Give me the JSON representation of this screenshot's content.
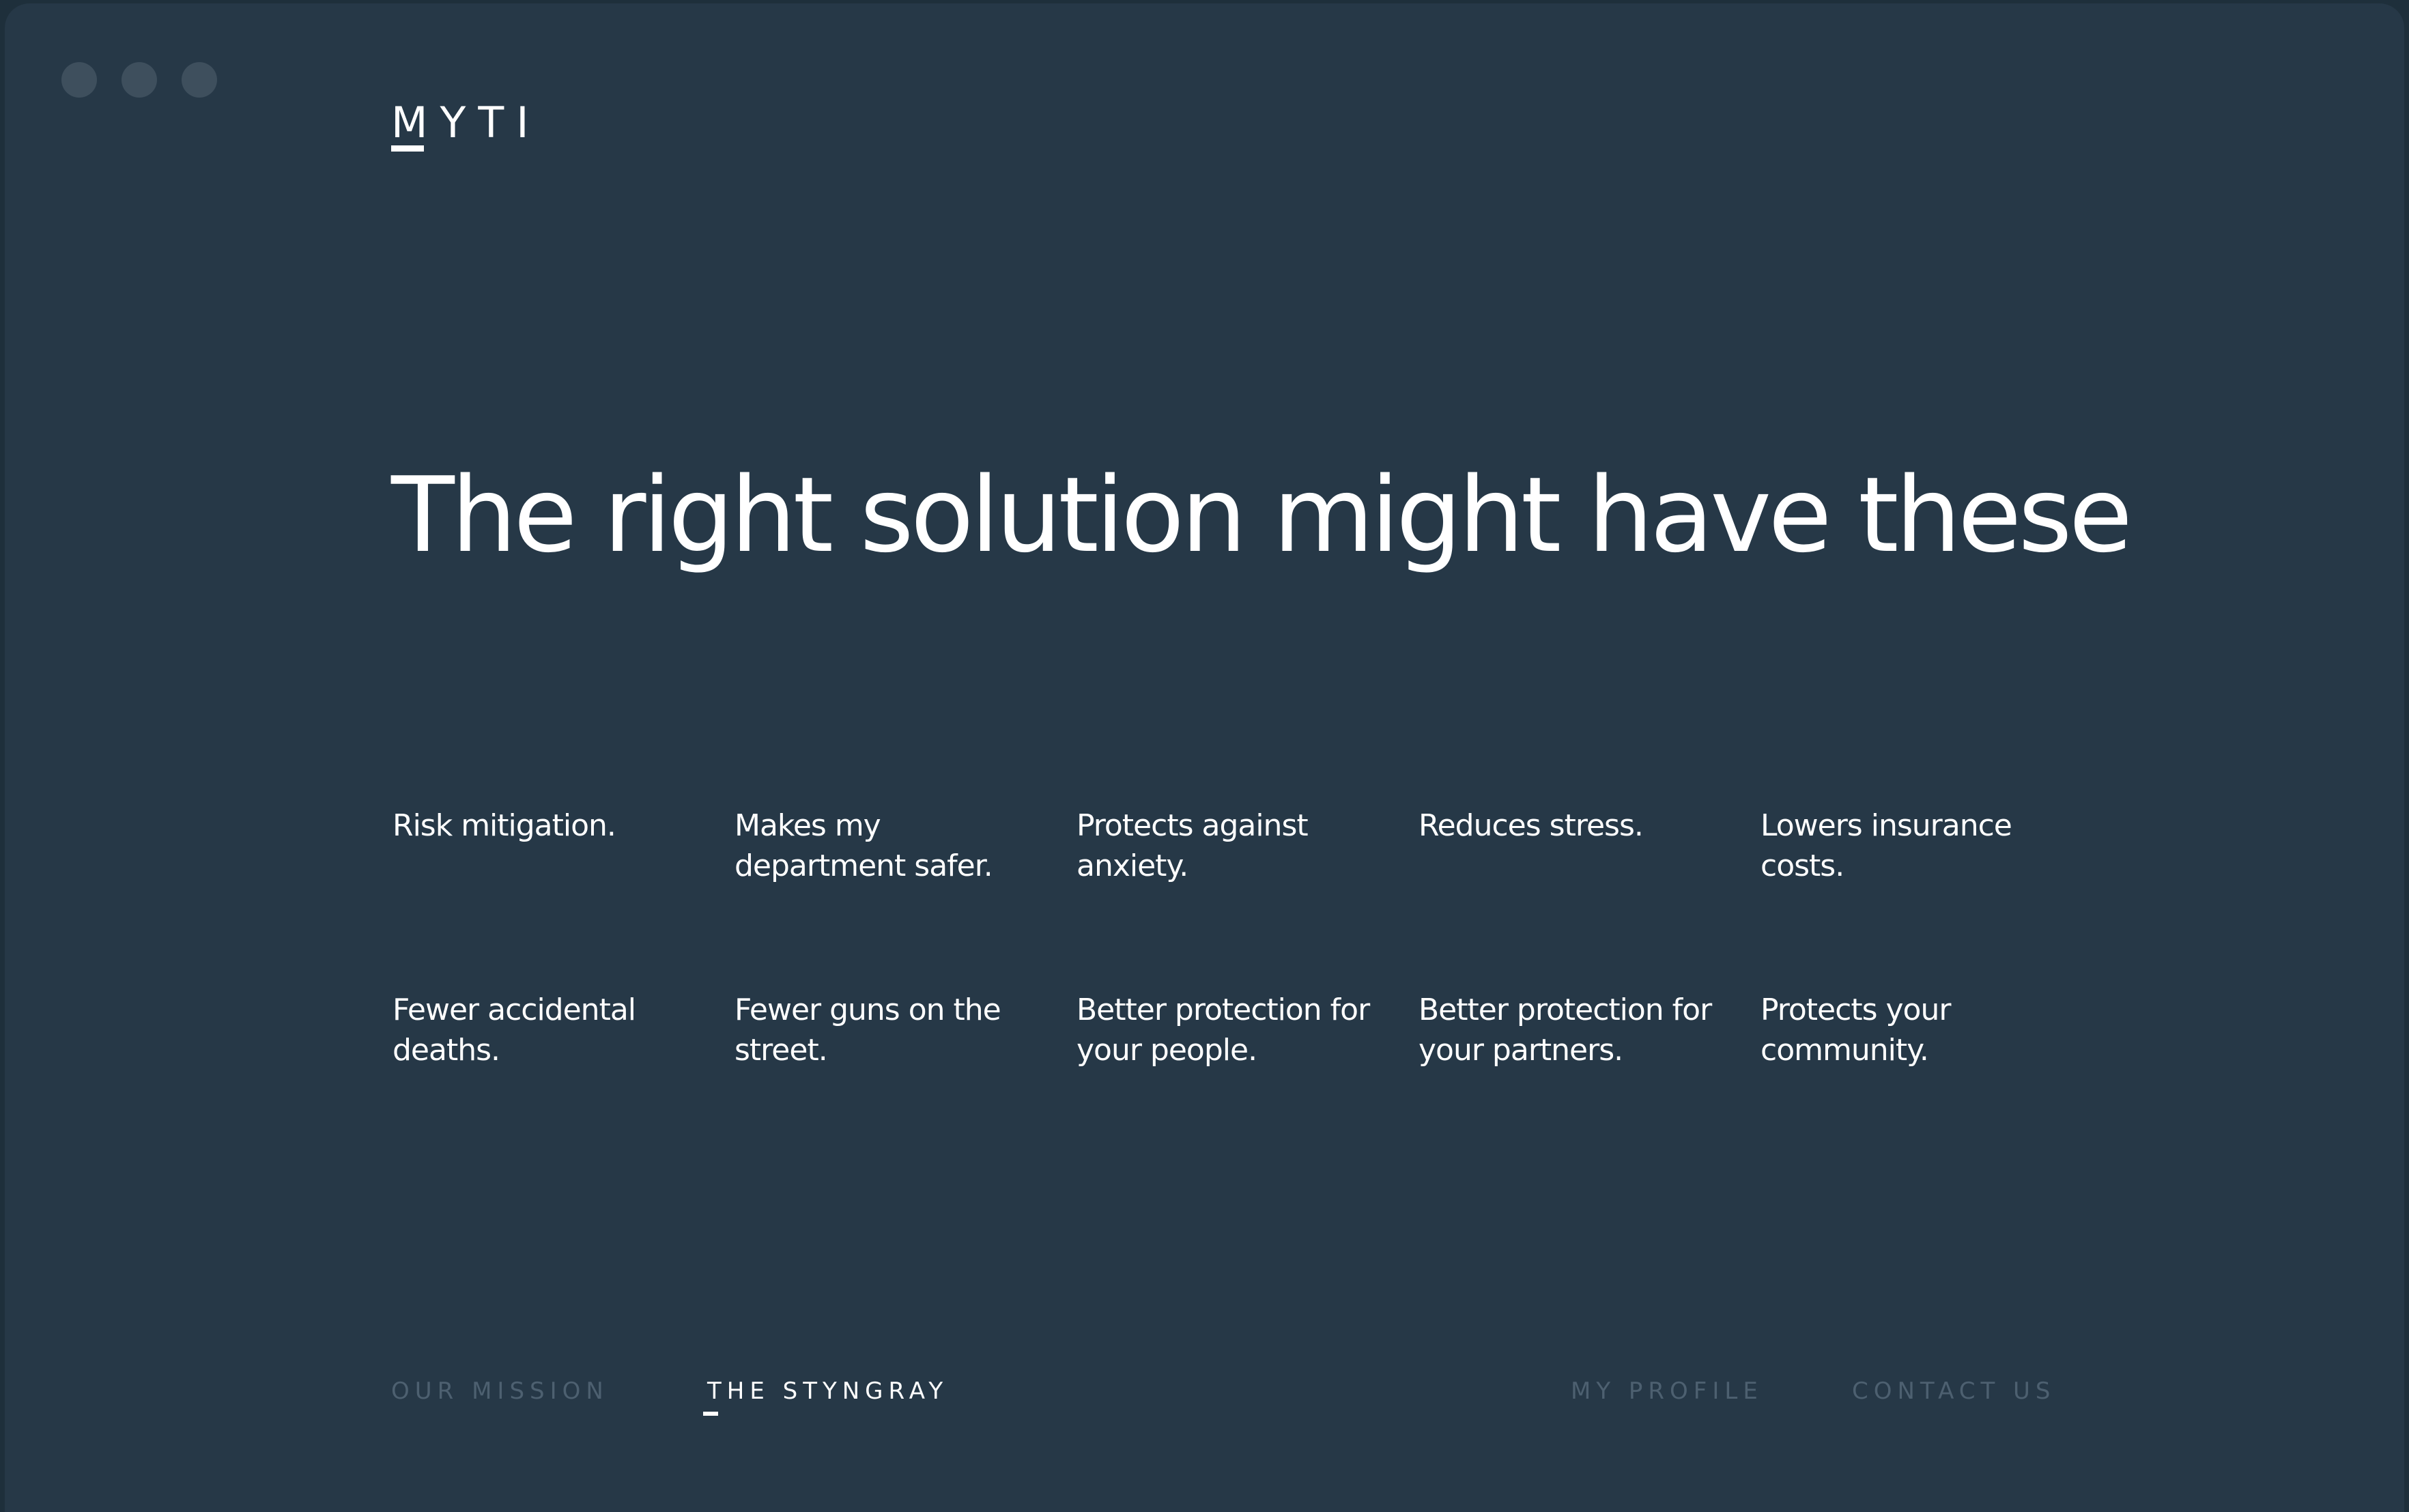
{
  "window": {
    "controls": [
      "close-dot",
      "minimize-dot",
      "maximize-dot"
    ]
  },
  "brand": {
    "letters": [
      "M",
      "Y",
      "T",
      "I"
    ]
  },
  "hero": {
    "headline": "The right solution might have these"
  },
  "benefits": [
    "Risk mitigation.",
    "Makes my department safer.",
    "Protects against anxiety.",
    "Reduces stress.",
    "Lowers insurance costs.",
    "Fewer accidental deaths.",
    "Fewer guns on the street.",
    "Better protection for your people.",
    "Better protection for your partners.",
    "Protects your community."
  ],
  "nav": {
    "our_mission": "OUR MISSION",
    "the_styngray": "THE STYNGRAY",
    "my_profile": "MY PROFILE",
    "contact_us": "CONTACT US",
    "active": "the_styngray"
  },
  "colors": {
    "background": "#263847",
    "text": "#ffffff",
    "muted_nav": "#4d6070",
    "window_controls": "#3e4f5d"
  }
}
